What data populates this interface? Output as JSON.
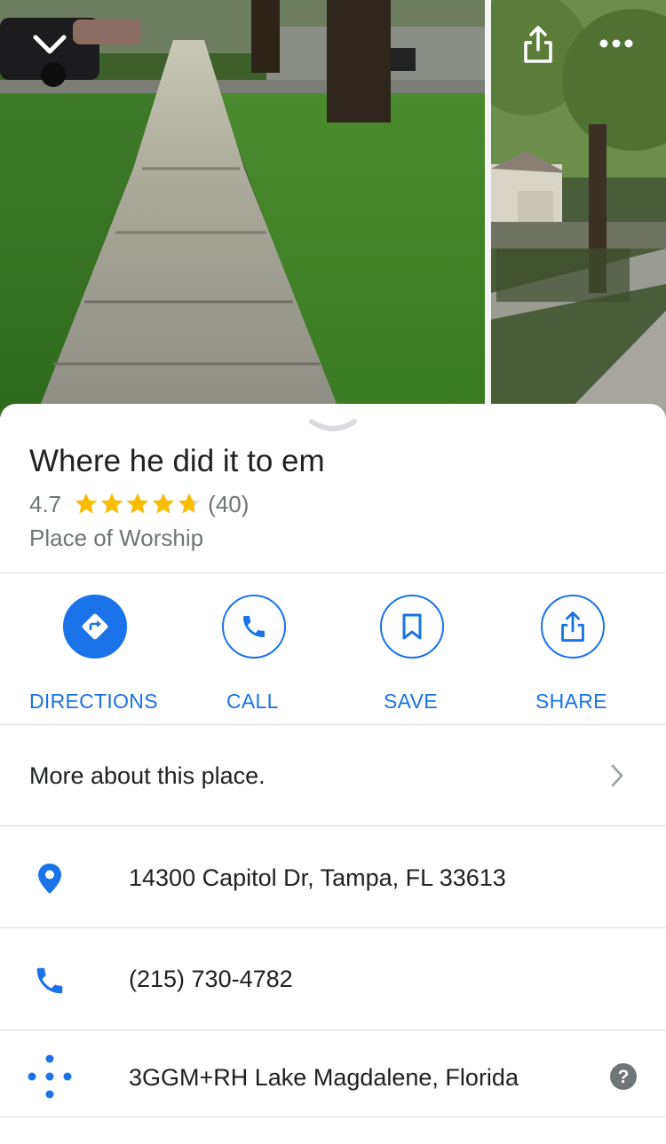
{
  "place": {
    "name": "Where he did it to em",
    "rating_value": "4.7",
    "rating_stars": 4.7,
    "review_count": "(40)",
    "category": "Place of Worship"
  },
  "actions": [
    {
      "label": "DIRECTIONS",
      "icon": "directions-icon"
    },
    {
      "label": "CALL",
      "icon": "phone-icon"
    },
    {
      "label": "SAVE",
      "icon": "bookmark-icon"
    },
    {
      "label": "SHARE",
      "icon": "share-icon"
    }
  ],
  "more_about": {
    "label": "More about this place."
  },
  "details": {
    "address": "14300 Capitol Dr, Tampa, FL 33613",
    "phone": "(215) 730-4782",
    "plus_code": "3GGM+RH Lake Magdalene, Florida"
  },
  "colors": {
    "accent": "#1a73e8",
    "star": "#fbbc04",
    "secondary_text": "#70757a",
    "divider": "#dadce0"
  }
}
